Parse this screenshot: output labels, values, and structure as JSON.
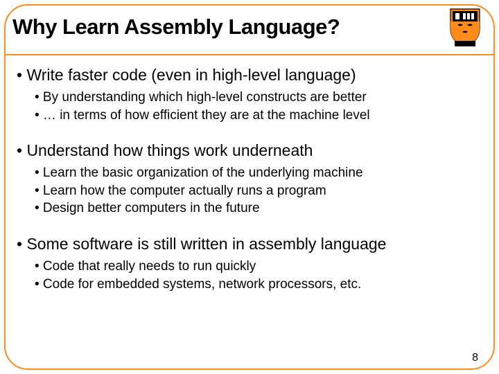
{
  "title": "Why Learn Assembly Language?",
  "logo_name": "princeton-shield-icon",
  "sections": [
    {
      "main": "• Write faster code (even in high-level language)",
      "subs": [
        "• By understanding which high-level constructs are better",
        "• … in terms of how efficient they are at the machine level"
      ]
    },
    {
      "main": "• Understand how things work underneath",
      "subs": [
        "• Learn the basic organization of the underlying machine",
        "• Learn how the computer actually runs a program",
        "• Design better computers in the future"
      ]
    },
    {
      "main": "• Some software is still written in assembly language",
      "subs": [
        "• Code that really needs to run quickly",
        "• Code for embedded systems, network processors, etc."
      ]
    }
  ],
  "page_number": "8"
}
